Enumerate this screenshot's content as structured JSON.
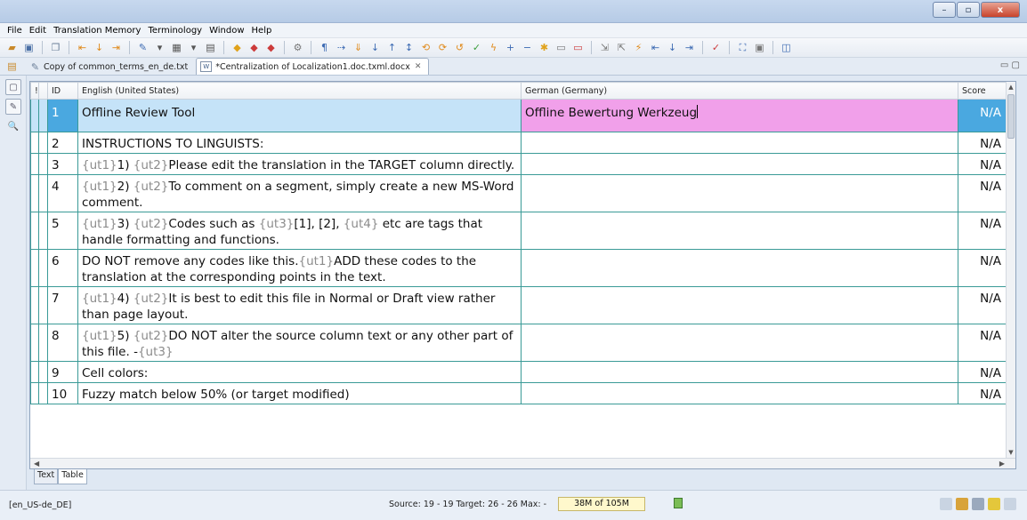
{
  "menu": [
    "File",
    "Edit",
    "Translation Memory",
    "Terminology",
    "Window",
    "Help"
  ],
  "window_controls": {
    "minimize": "–",
    "maximize": "▫",
    "close": "x"
  },
  "tabs": [
    {
      "label": "Copy of common_terms_en_de.txt",
      "active": false
    },
    {
      "label": "*Centralization of Localization1.doc.txml.docx",
      "active": true,
      "close": "✕"
    }
  ],
  "columns": {
    "flag": "!",
    "id": "ID",
    "source": "English (United States)",
    "target": "German (Germany)",
    "score": "Score"
  },
  "rows": [
    {
      "id": "1",
      "source": "Offline Review Tool",
      "target": "Offline Bewertung Werkzeug",
      "score": "N/A",
      "selected": true
    },
    {
      "id": "2",
      "source": "INSTRUCTIONS TO LINGUISTS:",
      "target": "",
      "score": "N/A"
    },
    {
      "id": "3",
      "source_parts": [
        "{ut1}",
        "1) ",
        "{ut2}",
        "Please edit the translation in the TARGET column directly."
      ],
      "target": "",
      "score": "N/A"
    },
    {
      "id": "4",
      "source_parts": [
        "{ut1}",
        "2) ",
        "{ut2}",
        "To comment on a segment, simply create a new MS-Word comment."
      ],
      "target": "",
      "score": "N/A"
    },
    {
      "id": "5",
      "source_parts": [
        "{ut1}",
        "3) ",
        "{ut2}",
        "Codes such as ",
        "{ut3}",
        "[1], [2], ",
        "{ut4}",
        " etc are tags that handle formatting and functions."
      ],
      "target": "",
      "score": "N/A"
    },
    {
      "id": "6",
      "source_parts": [
        "",
        "DO NOT remove any codes like this.",
        "{ut1}",
        "ADD these codes to the translation at the corresponding points in the text."
      ],
      "target": "",
      "score": "N/A"
    },
    {
      "id": "7",
      "source_parts": [
        "{ut1}",
        "4) ",
        "{ut2}",
        "It is best to edit this file in Normal or Draft view rather than page layout."
      ],
      "target": "",
      "score": "N/A"
    },
    {
      "id": "8",
      "source_parts": [
        "{ut1}",
        "5) ",
        "{ut2}",
        "DO NOT alter the source column text or any other part of this file. -",
        "{ut3}",
        ""
      ],
      "target": "",
      "score": "N/A"
    },
    {
      "id": "9",
      "source": "Cell colors:",
      "target": "",
      "score": "N/A"
    },
    {
      "id": "10",
      "source": "Fuzzy match below 50%   (or target modified)",
      "target": "",
      "score": "N/A"
    }
  ],
  "view_tabs": [
    "Text",
    "Table"
  ],
  "status": {
    "locale": "[en_US-de_DE]",
    "info": "Source: 19 - 19  Target: 26 - 26  Max: -",
    "memory": "38M of 105M"
  }
}
